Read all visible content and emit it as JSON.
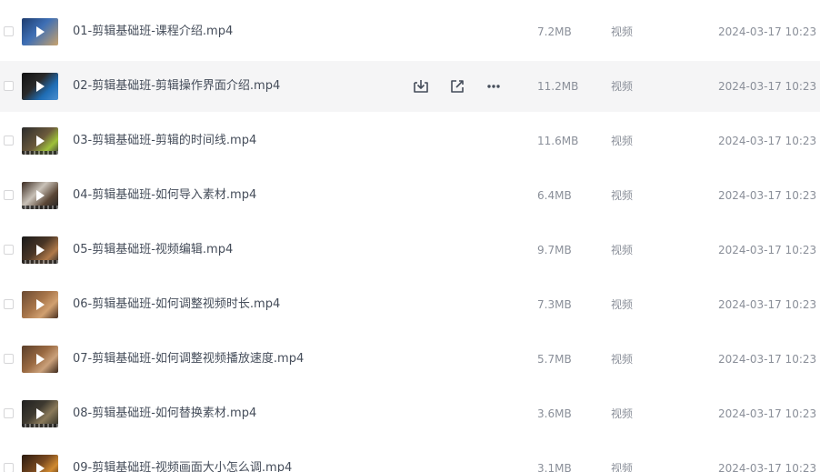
{
  "row_actions": {
    "download_icon": "download-icon",
    "share_icon": "share-icon",
    "more_icon": "more-icon"
  },
  "colors": {
    "row_hover": "#f5f5f6",
    "name_text": "#454d5a",
    "meta_text": "#8a8f99"
  },
  "files": [
    {
      "name": "01-剪辑基础班-课程介绍.mp4",
      "size": "7.2MB",
      "type": "视频",
      "date": "2024-03-17 10:23"
    },
    {
      "name": "02-剪辑基础班-剪辑操作界面介绍.mp4",
      "size": "11.2MB",
      "type": "视频",
      "date": "2024-03-17 10:23"
    },
    {
      "name": "03-剪辑基础班-剪辑的时间线.mp4",
      "size": "11.6MB",
      "type": "视频",
      "date": "2024-03-17 10:23"
    },
    {
      "name": "04-剪辑基础班-如何导入素材.mp4",
      "size": "6.4MB",
      "type": "视频",
      "date": "2024-03-17 10:23"
    },
    {
      "name": "05-剪辑基础班-视频编辑.mp4",
      "size": "9.7MB",
      "type": "视频",
      "date": "2024-03-17 10:23"
    },
    {
      "name": "06-剪辑基础班-如何调整视频时长.mp4",
      "size": "7.3MB",
      "type": "视频",
      "date": "2024-03-17 10:23"
    },
    {
      "name": "07-剪辑基础班-如何调整视频播放速度.mp4",
      "size": "5.7MB",
      "type": "视频",
      "date": "2024-03-17 10:23"
    },
    {
      "name": "08-剪辑基础班-如何替换素材.mp4",
      "size": "3.6MB",
      "type": "视频",
      "date": "2024-03-17 10:23"
    },
    {
      "name": "09-剪辑基础班-视频画面大小怎么调.mp4",
      "size": "3.1MB",
      "type": "视频",
      "date": "2024-03-17 10:23"
    }
  ]
}
